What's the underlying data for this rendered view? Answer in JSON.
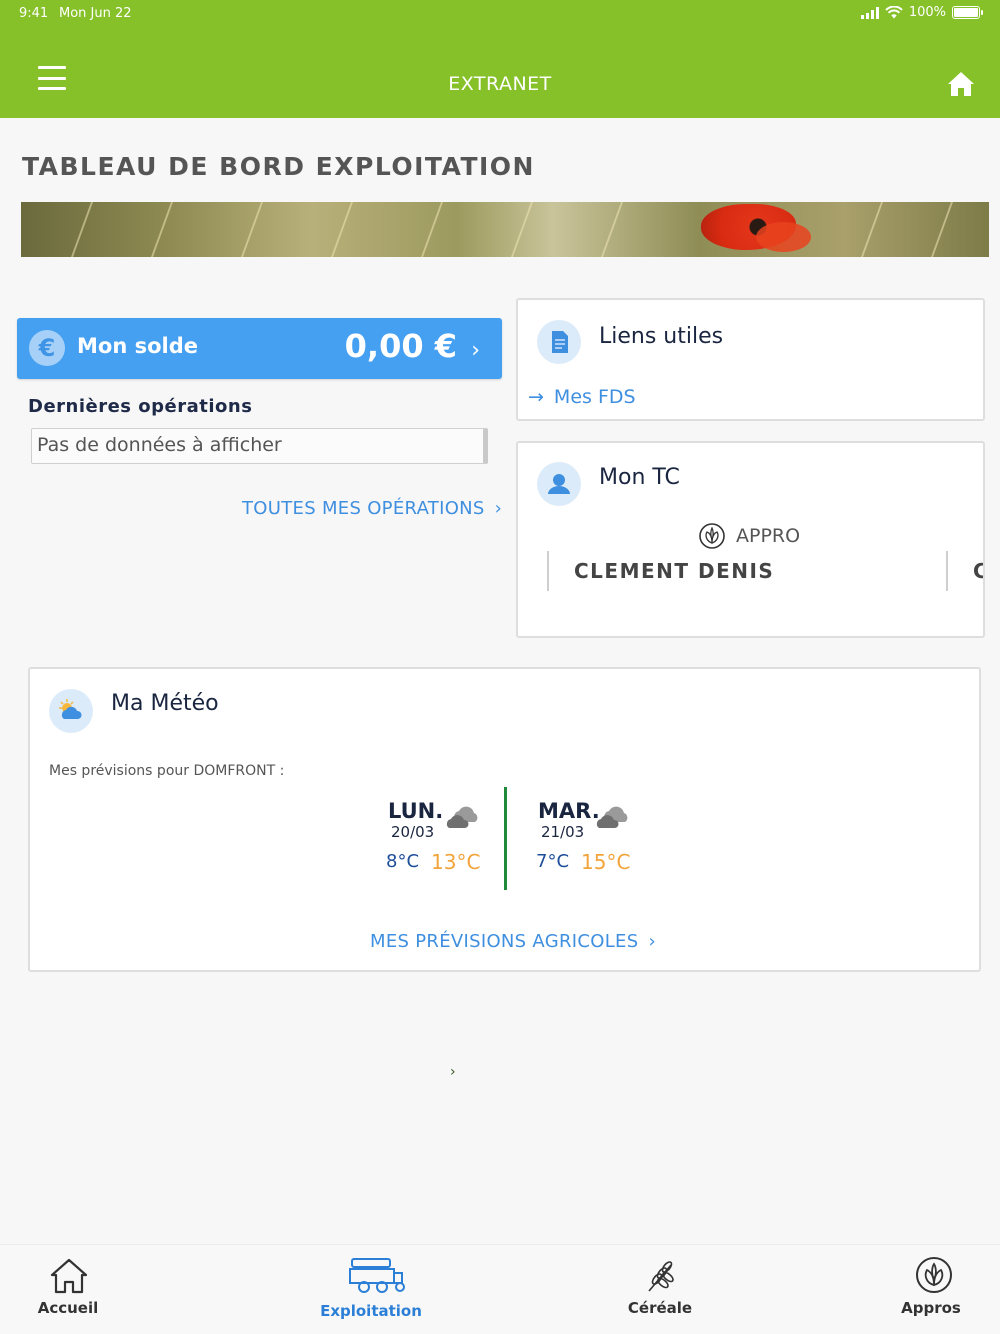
{
  "status_bar": {
    "time": "9:41",
    "date": "Mon Jun 22",
    "battery": "100%"
  },
  "header": {
    "title": "EXTRANET",
    "menu_icon": "hamburger-icon",
    "home_icon": "home-icon"
  },
  "page": {
    "title": "TABLEAU DE BORD EXPLOITATION"
  },
  "solde": {
    "label": "Mon solde",
    "amount": "0,00 €",
    "icon": "€"
  },
  "operations": {
    "title": "Dernières opérations",
    "empty_text": "Pas de données à afficher",
    "link": "TOUTES MES OPÉRATIONS"
  },
  "liens_utiles": {
    "title": "Liens utiles",
    "items": [
      {
        "label": "Mes FDS"
      }
    ]
  },
  "mon_tc": {
    "title": "Mon TC",
    "category": "APPRO",
    "name": "CLEMENT DENIS",
    "next_initial": "C"
  },
  "meteo": {
    "title": "Ma Météo",
    "forecast_label": "Mes prévisions pour DOMFRONT :",
    "days": [
      {
        "day": "LUN.",
        "date": "20/03",
        "min": "8°C",
        "max": "13°C",
        "icon": "cloud-icon"
      },
      {
        "day": "MAR.",
        "date": "21/03",
        "min": "7°C",
        "max": "15°C",
        "icon": "cloud-icon"
      }
    ],
    "link": "MES PRÉVISIONS AGRICOLES"
  },
  "tabs": [
    {
      "label": "Accueil",
      "icon": "home-outline-icon",
      "active": false
    },
    {
      "label": "Exploitation",
      "icon": "tractor-icon",
      "active": true
    },
    {
      "label": "Céréale",
      "icon": "wheat-icon",
      "active": false
    },
    {
      "label": "Appros",
      "icon": "leaf-circle-icon",
      "active": false
    }
  ],
  "colors": {
    "header": "#86c12a",
    "accent_blue": "#46a0f1",
    "link_blue": "#3f8fe0",
    "min_temp": "#1d4e9a",
    "max_temp": "#f2a43a",
    "divider_green": "#1e8a3a"
  }
}
